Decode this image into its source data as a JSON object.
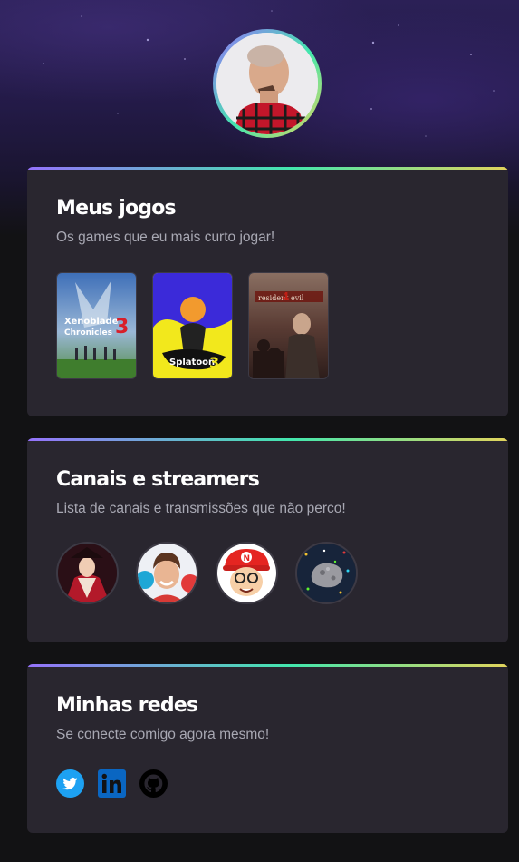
{
  "profile": {
    "avatar_icon": "profile-photo"
  },
  "cards": {
    "games": {
      "title": "Meus jogos",
      "subtitle": "Os games que eu mais curto jogar!",
      "items": [
        {
          "name": "xenoblade-chronicles-3-cover"
        },
        {
          "name": "splatoon-3-cover"
        },
        {
          "name": "resident-evil-4-cover"
        }
      ]
    },
    "channels": {
      "title": "Canais e streamers",
      "subtitle": "Lista de canais e transmissões que não perco!",
      "items": [
        {
          "name": "channel-avatar-1"
        },
        {
          "name": "channel-avatar-2"
        },
        {
          "name": "channel-avatar-3"
        },
        {
          "name": "channel-avatar-4"
        }
      ]
    },
    "socials": {
      "title": "Minhas redes",
      "subtitle": "Se conecte comigo agora mesmo!",
      "items": [
        {
          "icon": "twitter-icon",
          "color": "#1da1f2"
        },
        {
          "icon": "linkedin-icon",
          "color": "#0a66c2"
        },
        {
          "icon": "github-icon",
          "color": "#000000"
        }
      ]
    }
  },
  "colors": {
    "background": "#121214",
    "card": "#29262f",
    "gradient": [
      "#9572fc",
      "#43e7ad",
      "#e2d45c"
    ],
    "title": "#ffffff",
    "subtitle": "#a8a8b3"
  }
}
